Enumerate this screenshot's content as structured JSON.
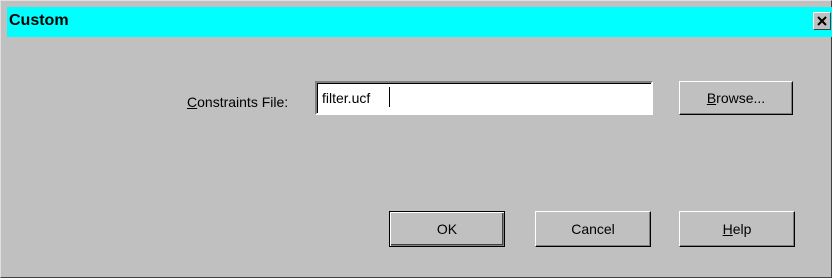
{
  "dialog": {
    "title": "Custom",
    "close_icon": "close-icon"
  },
  "form": {
    "constraints_label_mnemonic": "C",
    "constraints_label_rest": "onstraints File:",
    "constraints_value": "filter.ucf"
  },
  "buttons": {
    "browse_mnemonic": "B",
    "browse_rest": "rowse...",
    "ok_label": "OK",
    "cancel_label": "Cancel",
    "help_mnemonic": "H",
    "help_rest": "elp"
  },
  "colors": {
    "titlebar": "#00ffff",
    "dialog_face": "#c0c0c0"
  }
}
